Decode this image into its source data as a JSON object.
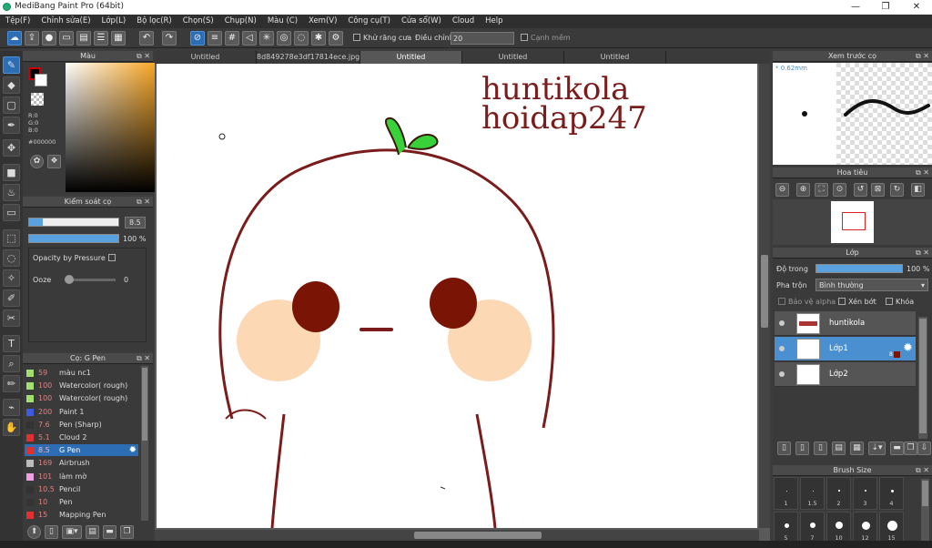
{
  "window": {
    "title": "MediBang Paint Pro (64bit)",
    "min": "—",
    "max": "❐",
    "close": "✕"
  },
  "menu": [
    "Tệp(F)",
    "Chỉnh sửa(E)",
    "Lớp(L)",
    "Bộ lọc(R)",
    "Chọn(S)",
    "Chụp(N)",
    "Màu (C)",
    "Xem(V)",
    "Công cụ(T)",
    "Cửa sổ(W)",
    "Cloud",
    "Help"
  ],
  "toolbar": {
    "antialias": "Khử răng cưa",
    "adjust": "Điều chỉnh",
    "adjust_value": "20",
    "edge": "Cạnh mềm"
  },
  "color_panel": {
    "title": "Màu",
    "r": "R:0",
    "g": "G:0",
    "b": "B:0",
    "hex": "#000000"
  },
  "brush_control": {
    "title": "Kiểm soát cọ",
    "size": "8.5",
    "opacity": "100 %",
    "opacity_pressure": "Opacity by Pressure",
    "ooze": "Ooze",
    "ooze_value": "0"
  },
  "brush_list": {
    "title": "Cọ: G Pen",
    "items": [
      {
        "size": "59",
        "name": "màu nc1",
        "color": "#9fe070"
      },
      {
        "size": "100",
        "name": "Watercolor( rough)",
        "color": "#9fe070"
      },
      {
        "size": "100",
        "name": "Watercolor( rough)",
        "color": "#9fe070"
      },
      {
        "size": "200",
        "name": "Paint 1",
        "color": "#3d5be0"
      },
      {
        "size": "7.6",
        "name": "Pen (Sharp)",
        "color": "#333"
      },
      {
        "size": "5.1",
        "name": "Cloud 2",
        "color": "#e03030"
      },
      {
        "size": "8.5",
        "name": "G Pen",
        "color": "#e03030"
      },
      {
        "size": "169",
        "name": "Airbrush",
        "color": "#bbb"
      },
      {
        "size": "101",
        "name": "làm mờ",
        "color": "#f0a0e0"
      },
      {
        "size": "10.5",
        "name": "Pencil",
        "color": "#333"
      },
      {
        "size": "10",
        "name": "Pen",
        "color": "#333"
      },
      {
        "size": "15",
        "name": "Mapping Pen",
        "color": "#e03030"
      }
    ]
  },
  "tabs": [
    "Untitled",
    "8d849278e3df17814ece.jpg",
    "Untitled",
    "Untitled",
    "Untitled"
  ],
  "canvas": {
    "text1": "huntikola",
    "text2": "hoidap247"
  },
  "preview": {
    "title": "Xem trước cọ",
    "size": "* 0.62mm"
  },
  "navigator": {
    "title": "Hoa tiêu"
  },
  "layer_panel": {
    "title": "Lớp",
    "opacity_label": "Độ trong",
    "opacity_value": "100 %",
    "blend_label": "Pha trộn",
    "blend_value": "Bình thường",
    "protect_alpha": "Bảo vệ alpha",
    "clipping": "Xén bớt",
    "lock": "Khóa",
    "layers": [
      {
        "name": "huntikola"
      },
      {
        "name": "Lớp1",
        "badge": "8"
      },
      {
        "name": "Lớp2"
      }
    ]
  },
  "brush_size": {
    "title": "Brush Size",
    "row1": [
      "1",
      "1.5",
      "2",
      "3",
      "4"
    ],
    "row2": [
      "5",
      "7",
      "10",
      "12",
      "15"
    ]
  }
}
